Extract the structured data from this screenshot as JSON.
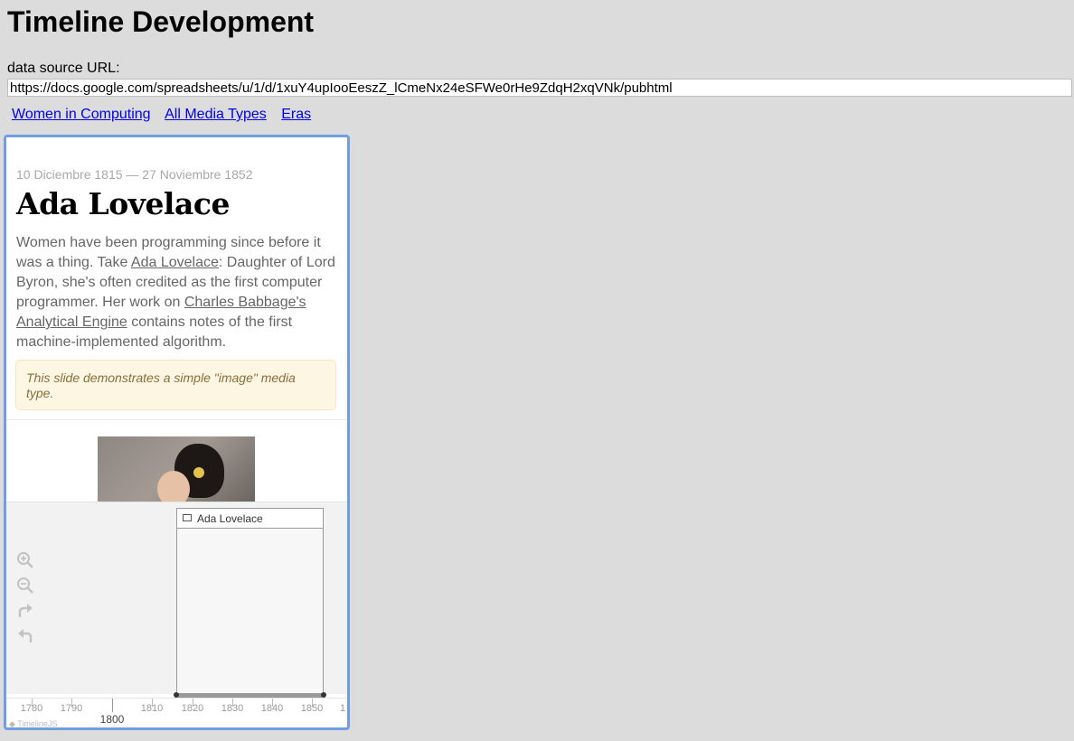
{
  "page": {
    "title": "Timeline Development",
    "source_label": "data source URL:",
    "source_url": "https://docs.google.com/spreadsheets/u/1/d/1xuY4upIooEeszZ_lCmeNx24eSFWe0rHe9ZdqH2xqVNk/pubhtml",
    "nav_links": [
      "Women in Computing",
      "All Media Types",
      "Eras"
    ]
  },
  "slide": {
    "dates": "10 Diciembre 1815 — 27 Noviembre 1852",
    "headline": "Ada Lovelace",
    "text_1": "Women have been programming since before it was a thing. Take ",
    "link_1": "Ada Lovelace",
    "text_2": ": Daughter of Lord Byron, she's often credited as the first computer programmer. Her work on ",
    "link_2": "Charles Babbage's Analytical Engine",
    "text_3": " contains notes of the first machine-implemented algorithm.",
    "note": "This slide demonstrates a simple \"image\" media type."
  },
  "timenav": {
    "controls": [
      "zoom-in-icon",
      "zoom-out-icon",
      "redo-icon",
      "undo-icon"
    ],
    "marker_label": "Ada Lovelace",
    "axis_ticks": [
      "1780",
      "1790",
      "1810",
      "1820",
      "1830",
      "1840",
      "1850",
      "1"
    ],
    "major_tick": "1800",
    "brand": "TimelineJS"
  }
}
